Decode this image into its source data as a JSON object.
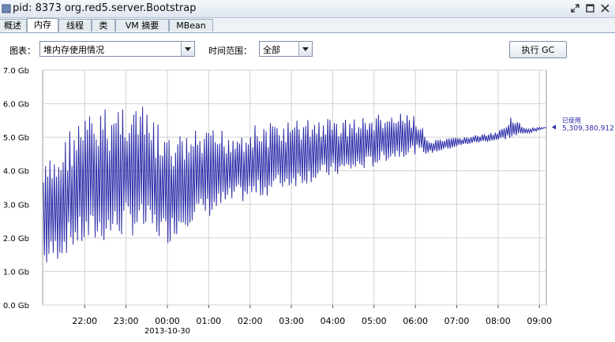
{
  "window": {
    "title": "pid: 8373 org.red5.server.Bootstrap"
  },
  "tabs": [
    {
      "label": "概述",
      "active": false
    },
    {
      "label": "内存",
      "active": true
    },
    {
      "label": "线程",
      "active": false
    },
    {
      "label": "类",
      "active": false
    },
    {
      "label": "VM 摘要",
      "active": false
    },
    {
      "label": "MBean",
      "active": false
    }
  ],
  "toolbar": {
    "chart_label": "图表：",
    "chart_select_value": "堆内存使用情况",
    "range_label": "时间范围：",
    "range_select_value": "全部",
    "gc_button_label": "执行 GC"
  },
  "colors": {
    "series": "#2b2ba8",
    "grid": "#d2d2d2"
  },
  "chart_data": {
    "type": "line",
    "series": [
      {
        "name": "已使用",
        "current_value": "5,309,380,912",
        "x": [
          "21:00",
          "21:20",
          "21:40",
          "22:00",
          "22:20",
          "22:40",
          "23:00",
          "23:20",
          "23:40",
          "00:00",
          "00:20",
          "00:40",
          "01:00",
          "01:20",
          "01:40",
          "02:00",
          "02:20",
          "02:40",
          "03:00",
          "03:20",
          "03:40",
          "04:00",
          "04:20",
          "04:40",
          "05:00",
          "05:20",
          "05:40",
          "06:00",
          "06:20",
          "06:40",
          "07:00",
          "07:20",
          "07:40",
          "08:00",
          "08:20",
          "08:40",
          "09:00",
          "09:10"
        ],
        "y_min": [
          1.0,
          1.3,
          1.6,
          1.7,
          1.8,
          1.9,
          2.0,
          2.1,
          2.0,
          1.8,
          2.2,
          2.5,
          2.6,
          2.8,
          3.0,
          3.1,
          3.2,
          3.4,
          3.5,
          3.6,
          3.7,
          3.8,
          3.9,
          4.0,
          4.1,
          4.3,
          4.4,
          4.5,
          4.5,
          4.6,
          4.7,
          4.8,
          4.85,
          4.9,
          4.95,
          5.1,
          5.2,
          5.3
        ],
        "y_max": [
          4.2,
          4.6,
          5.4,
          5.7,
          5.8,
          6.0,
          6.3,
          6.0,
          5.6,
          5.0,
          5.1,
          5.2,
          5.2,
          5.3,
          5.3,
          5.4,
          5.4,
          5.5,
          5.5,
          5.6,
          5.6,
          5.6,
          5.6,
          5.6,
          5.7,
          5.7,
          5.7,
          5.7,
          4.9,
          4.95,
          5.0,
          5.05,
          5.1,
          5.15,
          5.7,
          5.25,
          5.3,
          5.3
        ]
      }
    ],
    "y_ticks": [
      "0.0 Gb",
      "1.0 Gb",
      "2.0 Gb",
      "3.0 Gb",
      "4.0 Gb",
      "5.0 Gb",
      "6.0 Gb",
      "7.0 Gb"
    ],
    "x_ticks": [
      "22:00",
      "23:00",
      "00:00",
      "01:00",
      "02:00",
      "03:00",
      "04:00",
      "05:00",
      "06:00",
      "07:00",
      "08:00",
      "09:00"
    ],
    "x_date": "2013-10-30",
    "ylim": [
      0,
      7
    ],
    "grid": true,
    "legend": "right"
  }
}
